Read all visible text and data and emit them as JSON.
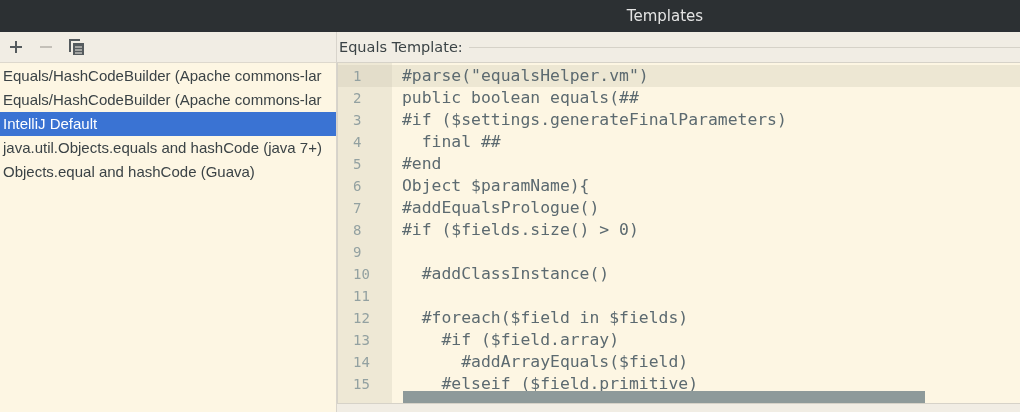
{
  "window": {
    "title": "Templates"
  },
  "toolbar": [
    {
      "kind": "add",
      "disabled": false
    },
    {
      "kind": "remove",
      "disabled": true
    },
    {
      "kind": "copy",
      "disabled": false
    }
  ],
  "templates": [
    {
      "label": "Equals/HashCodeBuilder (Apache commons-lar",
      "selected": false
    },
    {
      "label": "Equals/HashCodeBuilder (Apache commons-lar",
      "selected": false
    },
    {
      "label": "IntelliJ Default",
      "selected": true
    },
    {
      "label": "java.util.Objects.equals and hashCode (java 7+)",
      "selected": false
    },
    {
      "label": "Objects.equal and hashCode (Guava)",
      "selected": false
    }
  ],
  "editor": {
    "label": "Equals Template:",
    "lines": [
      {
        "number": "1",
        "code": "#parse(\"equalsHelper.vm\")",
        "highlighted": true
      },
      {
        "number": "2",
        "code": "public boolean equals(##",
        "highlighted": false
      },
      {
        "number": "3",
        "code": "#if ($settings.generateFinalParameters)",
        "highlighted": false
      },
      {
        "number": "4",
        "code": "  final ##",
        "highlighted": false
      },
      {
        "number": "5",
        "code": "#end",
        "highlighted": false
      },
      {
        "number": "6",
        "code": "Object $paramName){",
        "highlighted": false
      },
      {
        "number": "7",
        "code": "#addEqualsPrologue()",
        "highlighted": false
      },
      {
        "number": "8",
        "code": "#if ($fields.size() > 0)",
        "highlighted": false
      },
      {
        "number": "9",
        "highlighted": false
      },
      {
        "number": "10",
        "code": "  #addClassInstance()",
        "highlighted": false
      },
      {
        "number": "11",
        "highlighted": false
      },
      {
        "number": "12",
        "code": "  #foreach($field in $fields)",
        "highlighted": false
      },
      {
        "number": "13",
        "code": "    #if ($field.array)",
        "highlighted": false
      },
      {
        "number": "14",
        "code": "      #addArrayEquals($field)",
        "highlighted": false
      },
      {
        "number": "15",
        "code": "    #elseif ($field.primitive)",
        "highlighted": false
      }
    ]
  }
}
